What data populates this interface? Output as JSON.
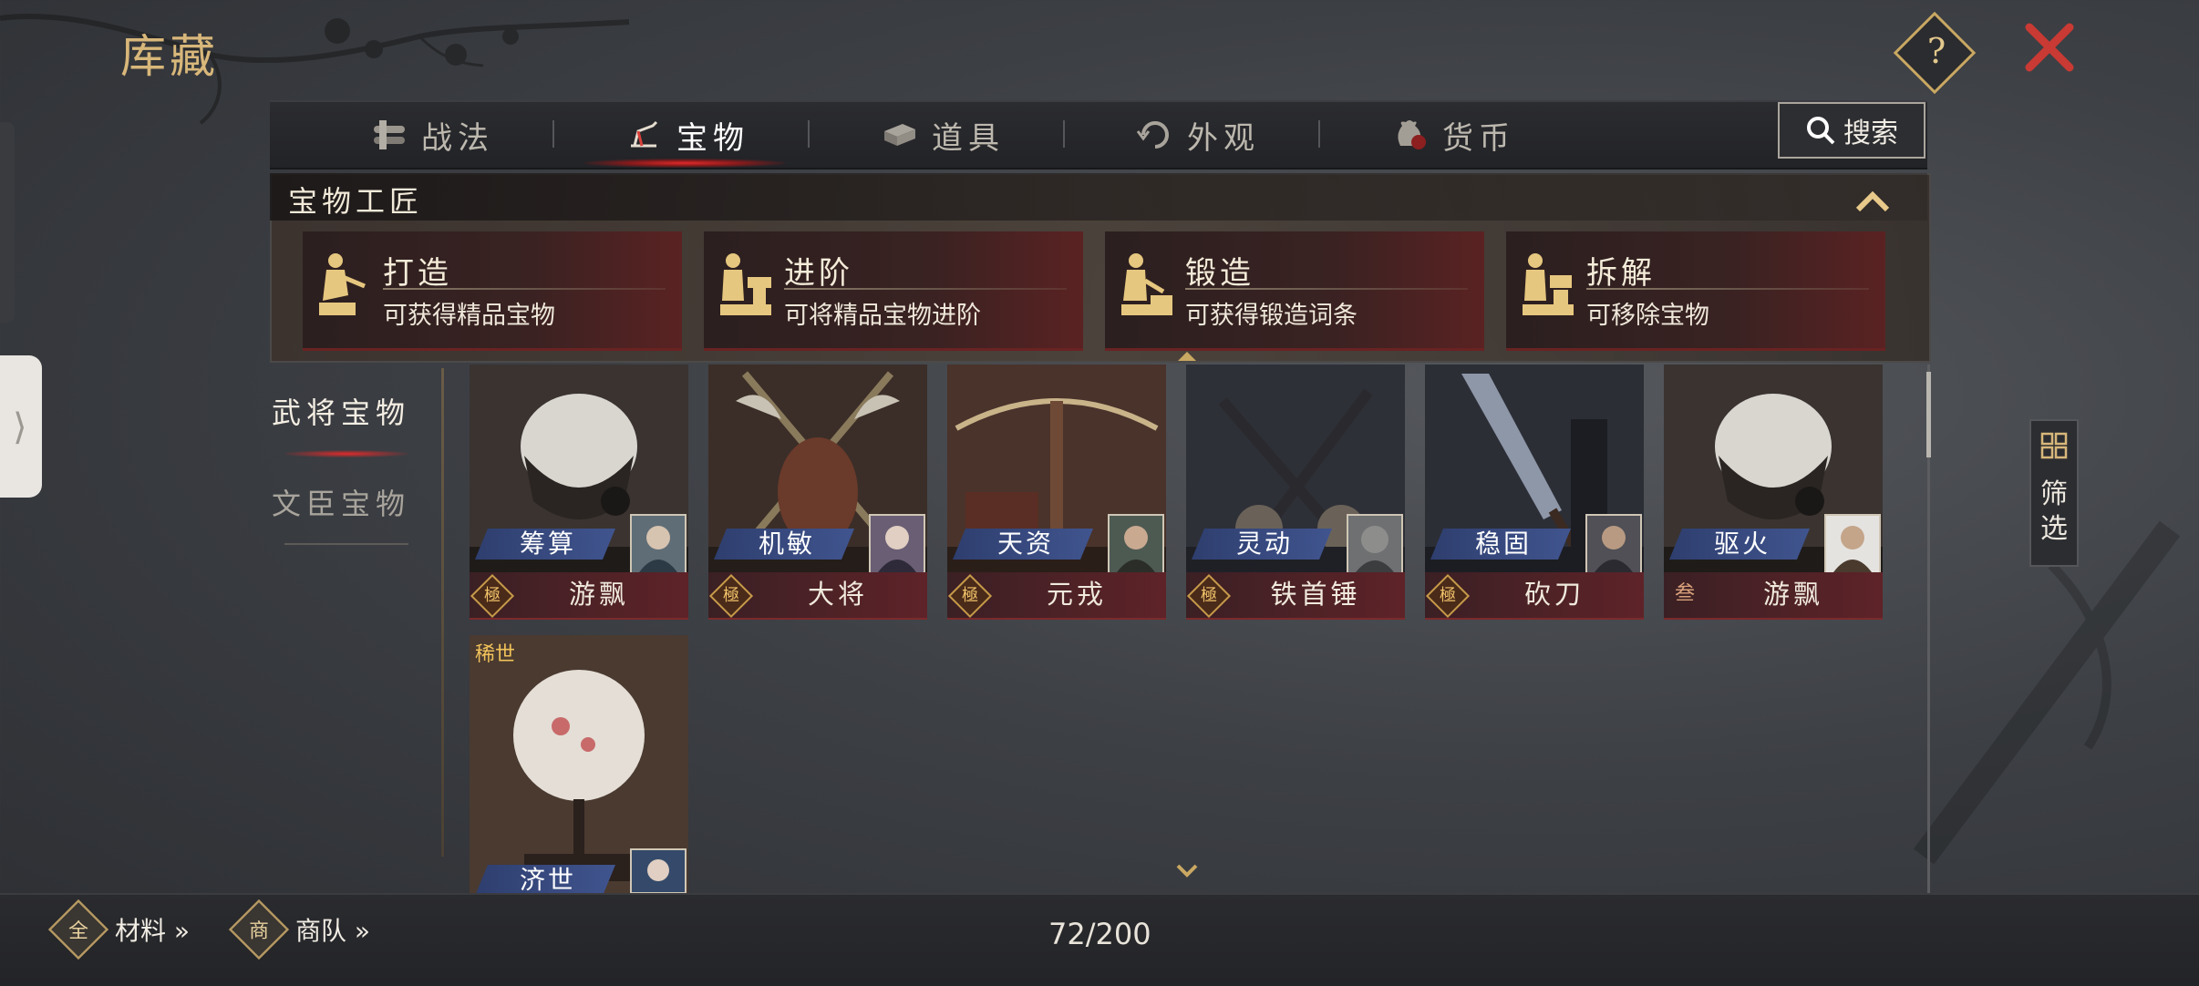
{
  "header": {
    "title": "库藏",
    "help_label": "?"
  },
  "tabs": [
    {
      "label": "战法",
      "icon": "scrolls-icon",
      "active": false
    },
    {
      "label": "宝物",
      "icon": "treasure-icon",
      "active": true
    },
    {
      "label": "道具",
      "icon": "items-icon",
      "active": false
    },
    {
      "label": "外观",
      "icon": "appearance-icon",
      "active": false
    },
    {
      "label": "货币",
      "icon": "money-bag-icon",
      "active": false
    }
  ],
  "search": {
    "label": "搜索"
  },
  "craft": {
    "title": "宝物工匠",
    "cards": [
      {
        "title": "打造",
        "desc": "可获得精品宝物"
      },
      {
        "title": "进阶",
        "desc": "可将精品宝物进阶"
      },
      {
        "title": "锻造",
        "desc": "可获得锻造词条"
      },
      {
        "title": "拆解",
        "desc": "可移除宝物"
      }
    ]
  },
  "categories": [
    {
      "label": "武将宝物",
      "active": true
    },
    {
      "label": "文臣宝物",
      "active": false
    }
  ],
  "treasures": [
    {
      "attr": "筹算",
      "grade": "極",
      "name": "游飘",
      "art": "feather-fan"
    },
    {
      "attr": "机敏",
      "grade": "極",
      "name": "大将",
      "art": "crossed-halberds"
    },
    {
      "attr": "天资",
      "grade": "極",
      "name": "元戎",
      "art": "crossbow"
    },
    {
      "attr": "灵动",
      "grade": "極",
      "name": "铁首锤",
      "art": "crossed-hammers"
    },
    {
      "attr": "稳固",
      "grade": "極",
      "name": "砍刀",
      "art": "broad-blade"
    },
    {
      "attr": "驱火",
      "grade": "叁",
      "name": "游飘",
      "art": "feather-fan"
    },
    {
      "attr": "济世",
      "rare": "稀世",
      "art": "round-fan"
    }
  ],
  "filter": {
    "label": "筛选"
  },
  "bottom": {
    "materials": "材料 »",
    "materials_icon": "全",
    "caravan": "商队 »",
    "caravan_icon": "商",
    "count": "72/200"
  },
  "colors": {
    "gold": "#d8b77a",
    "accent_red": "#e02a2a",
    "attr_blue": "#40548e"
  }
}
